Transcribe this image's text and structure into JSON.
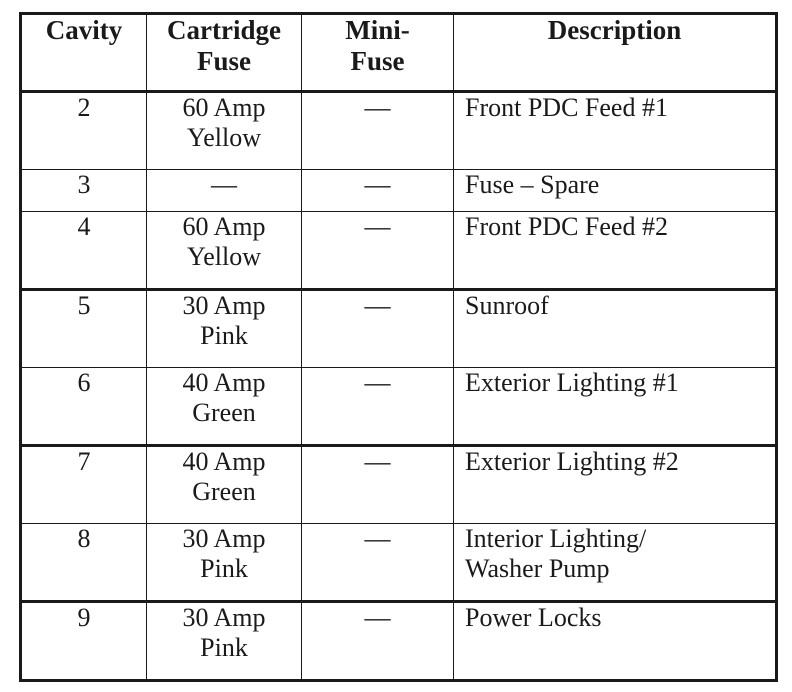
{
  "table": {
    "columns": [
      {
        "key": "cavity",
        "label_lines": [
          "Cavity"
        ],
        "align": "center"
      },
      {
        "key": "cartridge",
        "label_lines": [
          "Cartridge",
          "Fuse"
        ],
        "align": "center"
      },
      {
        "key": "mini",
        "label_lines": [
          "Mini-",
          "Fuse"
        ],
        "align": "center"
      },
      {
        "key": "description",
        "label_lines": [
          "Description"
        ],
        "align": "left"
      }
    ],
    "rows": [
      {
        "cavity": "2",
        "cartridge_lines": [
          "60 Amp",
          "Yellow"
        ],
        "mini": "—",
        "description_lines": [
          "Front PDC Feed #1"
        ]
      },
      {
        "cavity": "3",
        "cartridge_lines": [
          "—"
        ],
        "mini": "—",
        "description_lines": [
          "Fuse – Spare"
        ]
      },
      {
        "cavity": "4",
        "cartridge_lines": [
          "60 Amp",
          "Yellow"
        ],
        "mini": "—",
        "description_lines": [
          "Front PDC Feed #2"
        ]
      },
      {
        "cavity": "5",
        "cartridge_lines": [
          "30 Amp",
          "Pink"
        ],
        "mini": "—",
        "description_lines": [
          "Sunroof"
        ]
      },
      {
        "cavity": "6",
        "cartridge_lines": [
          "40 Amp",
          "Green"
        ],
        "mini": "—",
        "description_lines": [
          "Exterior Lighting #1"
        ]
      },
      {
        "cavity": "7",
        "cartridge_lines": [
          "40 Amp",
          "Green"
        ],
        "mini": "—",
        "description_lines": [
          "Exterior Lighting #2"
        ]
      },
      {
        "cavity": "8",
        "cartridge_lines": [
          "30 Amp",
          "Pink"
        ],
        "mini": "—",
        "description_lines": [
          "Interior Lighting/",
          "Washer Pump"
        ]
      },
      {
        "cavity": "9",
        "cartridge_lines": [
          "30 Amp",
          "Pink"
        ],
        "mini": "—",
        "description_lines": [
          "Power Locks"
        ]
      }
    ]
  },
  "style": {
    "text_color": "#1a1a1a",
    "background": "#ffffff",
    "rule_color": "#1a1a1a"
  }
}
